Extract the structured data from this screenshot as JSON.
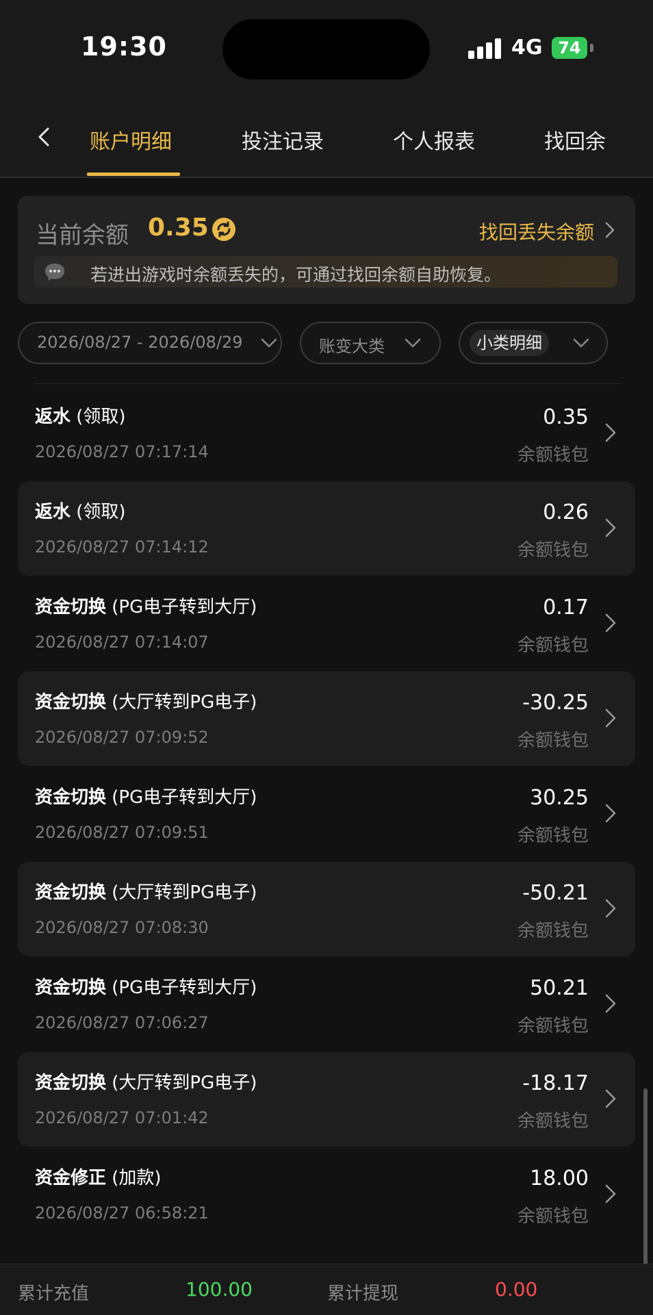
{
  "status_bar": {
    "time": "19:30",
    "network": "4G",
    "battery": "74"
  },
  "tabs": [
    {
      "label": "账户明细",
      "active": true
    },
    {
      "label": "投注记录",
      "active": false
    },
    {
      "label": "个人报表",
      "active": false
    },
    {
      "label": "找回余",
      "active": false
    }
  ],
  "balance": {
    "label": "当前余额",
    "value": "0.35",
    "recover_link": "找回丢失余额",
    "notice": "若进出游戏时余额丢失的，可通过找回余额自助恢复。"
  },
  "filters": {
    "date_range": "2026/08/27 - 2026/08/29",
    "category": "账变大类",
    "subcategory": "小类明细"
  },
  "transactions": [
    {
      "title": "返水",
      "detail": " (领取)",
      "time": "2026/08/27 07:17:14",
      "amount": "0.35",
      "wallet": "余额钱包"
    },
    {
      "title": "返水",
      "detail": " (领取)",
      "time": "2026/08/27 07:14:12",
      "amount": "0.26",
      "wallet": "余额钱包"
    },
    {
      "title": "资金切换",
      "detail": " (PG电子转到大厅)",
      "time": "2026/08/27 07:14:07",
      "amount": "0.17",
      "wallet": "余额钱包"
    },
    {
      "title": "资金切换",
      "detail": " (大厅转到PG电子)",
      "time": "2026/08/27 07:09:52",
      "amount": "-30.25",
      "wallet": "余额钱包"
    },
    {
      "title": "资金切换",
      "detail": " (PG电子转到大厅)",
      "time": "2026/08/27 07:09:51",
      "amount": "30.25",
      "wallet": "余额钱包"
    },
    {
      "title": "资金切换",
      "detail": " (大厅转到PG电子)",
      "time": "2026/08/27 07:08:30",
      "amount": "-50.21",
      "wallet": "余额钱包"
    },
    {
      "title": "资金切换",
      "detail": " (PG电子转到大厅)",
      "time": "2026/08/27 07:06:27",
      "amount": "50.21",
      "wallet": "余额钱包"
    },
    {
      "title": "资金切换",
      "detail": " (大厅转到PG电子)",
      "time": "2026/08/27 07:01:42",
      "amount": "-18.17",
      "wallet": "余额钱包"
    },
    {
      "title": "资金修正",
      "detail": " (加款)",
      "time": "2026/08/27 06:58:21",
      "amount": "18.00",
      "wallet": "余额钱包"
    }
  ],
  "footer": {
    "deposit_label": "累计充值",
    "deposit_value": "100.00",
    "withdraw_label": "累计提现",
    "withdraw_value": "0.00"
  },
  "colors": {
    "accent": "#e9b949",
    "positive": "#4cd964",
    "negative": "#ff4d4d"
  }
}
